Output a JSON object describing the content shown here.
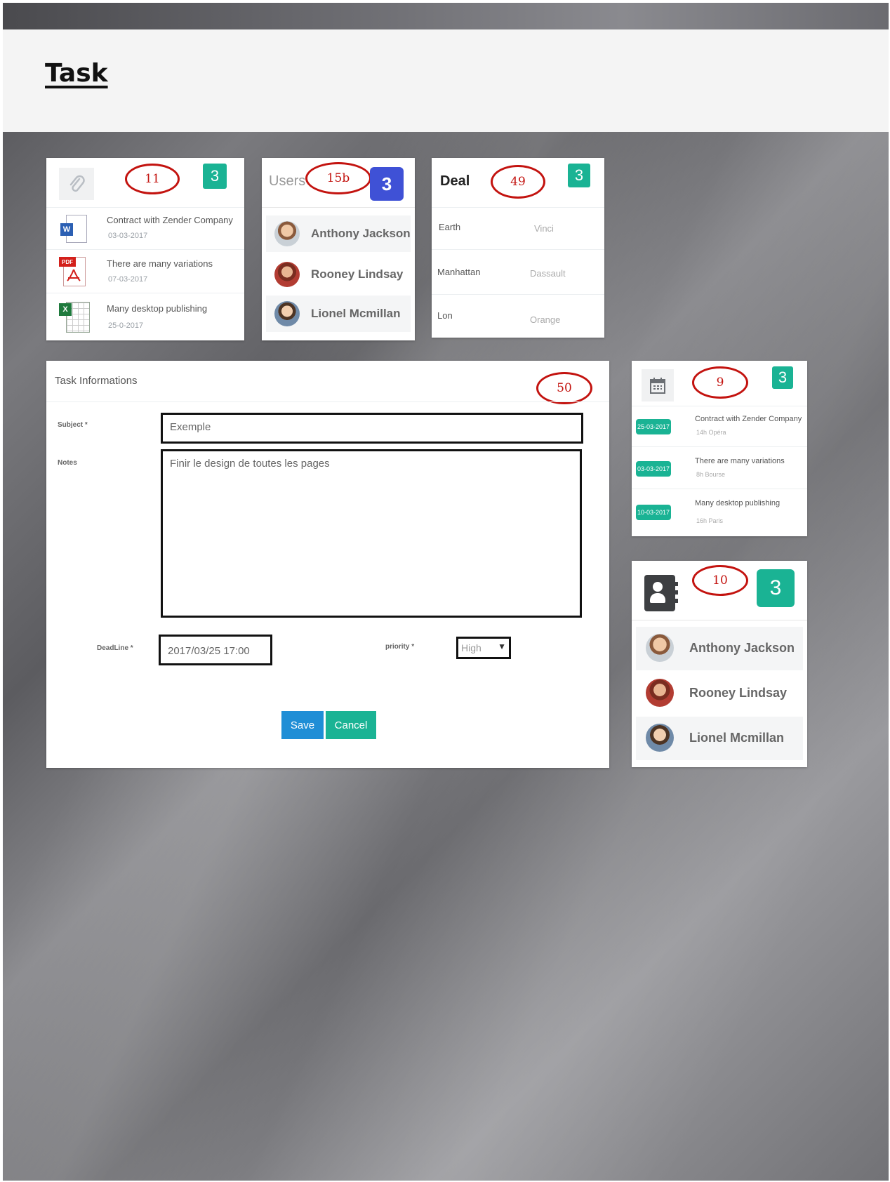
{
  "page": {
    "title": "Task"
  },
  "attachments": {
    "annotation": "11",
    "badge": "3",
    "items": [
      {
        "title": "Contract with Zender Company",
        "date": "03-03-2017",
        "icon": "word-doc-icon"
      },
      {
        "title": "There are many variations",
        "date": "07-03-2017",
        "icon": "pdf-icon"
      },
      {
        "title": "Many desktop publishing",
        "date": "25-0-2017",
        "icon": "excel-icon"
      }
    ]
  },
  "users": {
    "title": "Users",
    "annotation": "15b",
    "badge": "3",
    "items": [
      "Anthony Jackson",
      "Rooney Lindsay",
      "Lionel Mcmillan"
    ]
  },
  "deal": {
    "title": "Deal",
    "annotation": "49",
    "badge": "3",
    "rows": [
      {
        "city": "Earth",
        "company": "Vinci"
      },
      {
        "city": "Manhattan",
        "company": "Dassault"
      },
      {
        "city": "Lon",
        "company": "Orange"
      }
    ]
  },
  "task_info": {
    "title": "Task Informations",
    "annotation": "50",
    "subject_label": "Subject *",
    "subject_value": "Exemple",
    "notes_label": "Notes",
    "notes_value": "Finir le design de toutes les pages",
    "deadline_label": "DeadLine *",
    "deadline_value": "2017/03/25 17:00",
    "priority_label": "priority *",
    "priority_value": "High",
    "save_label": "Save",
    "cancel_label": "Cancel"
  },
  "calendar": {
    "annotation": "9",
    "badge": "3",
    "items": [
      {
        "date": "25-03-2017",
        "title": "Contract with Zender Company",
        "sub": "14h  Opéra"
      },
      {
        "date": "03-03-2017",
        "title": "There are many variations",
        "sub": "8h Bourse"
      },
      {
        "date": "10-03-2017",
        "title": "Many desktop publishing",
        "sub": "16h Paris"
      }
    ]
  },
  "contacts": {
    "annotation": "10",
    "badge": "3",
    "items": [
      "Anthony Jackson",
      "Rooney Lindsay",
      "Lionel Mcmillan"
    ]
  },
  "colors": {
    "accent": "#1ab394",
    "users_badge": "#3f51d6",
    "save_button": "#1f8ed6",
    "annotation": "#c3130f"
  }
}
